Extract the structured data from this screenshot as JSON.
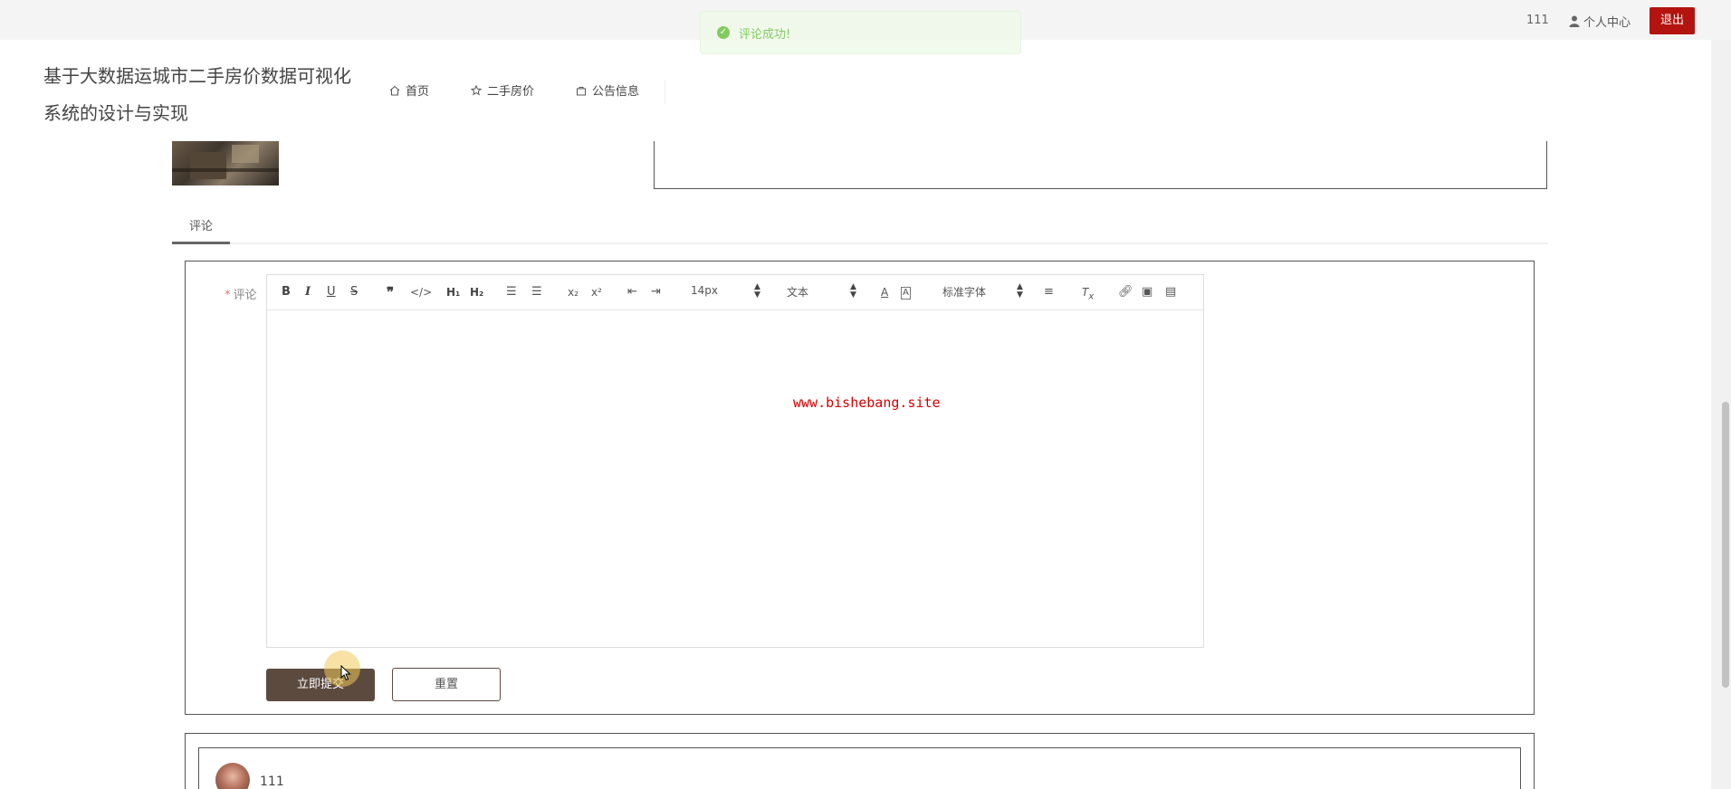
{
  "topbar": {
    "user_id": "111",
    "personal_center_label": "个人中心",
    "logout_label": "退出"
  },
  "toast": {
    "message": "评论成功!",
    "color": "#67c23a"
  },
  "header": {
    "site_title": "基于大数据运城市二手房价数据可视化系统的设计与实现",
    "nav": [
      {
        "label": "首页",
        "icon": "home-icon"
      },
      {
        "label": "二手房价",
        "icon": "star-icon"
      },
      {
        "label": "公告信息",
        "icon": "bag-icon"
      }
    ]
  },
  "tabs": {
    "comment": "评论"
  },
  "form": {
    "required_mark": "*",
    "comment_label": "评论",
    "toolbar": {
      "font_size": "14px",
      "text_type": "文本",
      "font_family": "标准字体"
    },
    "submit_label": "立即提交",
    "reset_label": "重置"
  },
  "watermark": "www.bishebang.site",
  "comments": [
    {
      "user": "111"
    }
  ],
  "colors": {
    "accent_red": "#b3140f",
    "button_brown": "#5c4a3f",
    "success_green": "#67c23a"
  }
}
